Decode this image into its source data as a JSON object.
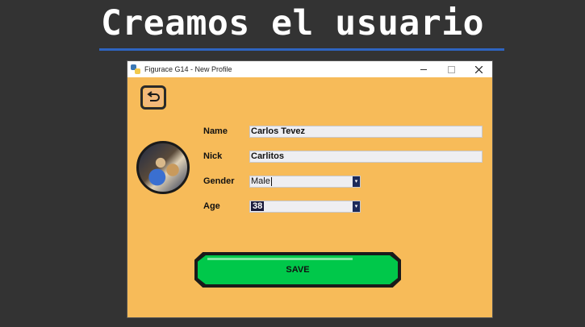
{
  "slide": {
    "title": "Creamos el usuario"
  },
  "window": {
    "title": "Figurace G14 - New Profile"
  },
  "form": {
    "name_label": "Name",
    "name_value": "Carlos Tevez",
    "nick_label": "Nick",
    "nick_value": "Carlitos",
    "gender_label": "Gender",
    "gender_value": "Male",
    "age_label": "Age",
    "age_value": "38"
  },
  "buttons": {
    "save_label": "SAVE"
  },
  "colors": {
    "window_background": "#f7bb59",
    "save_button": "#00c84a",
    "title_underline": "#2e64c0",
    "slide_background": "#333333"
  }
}
